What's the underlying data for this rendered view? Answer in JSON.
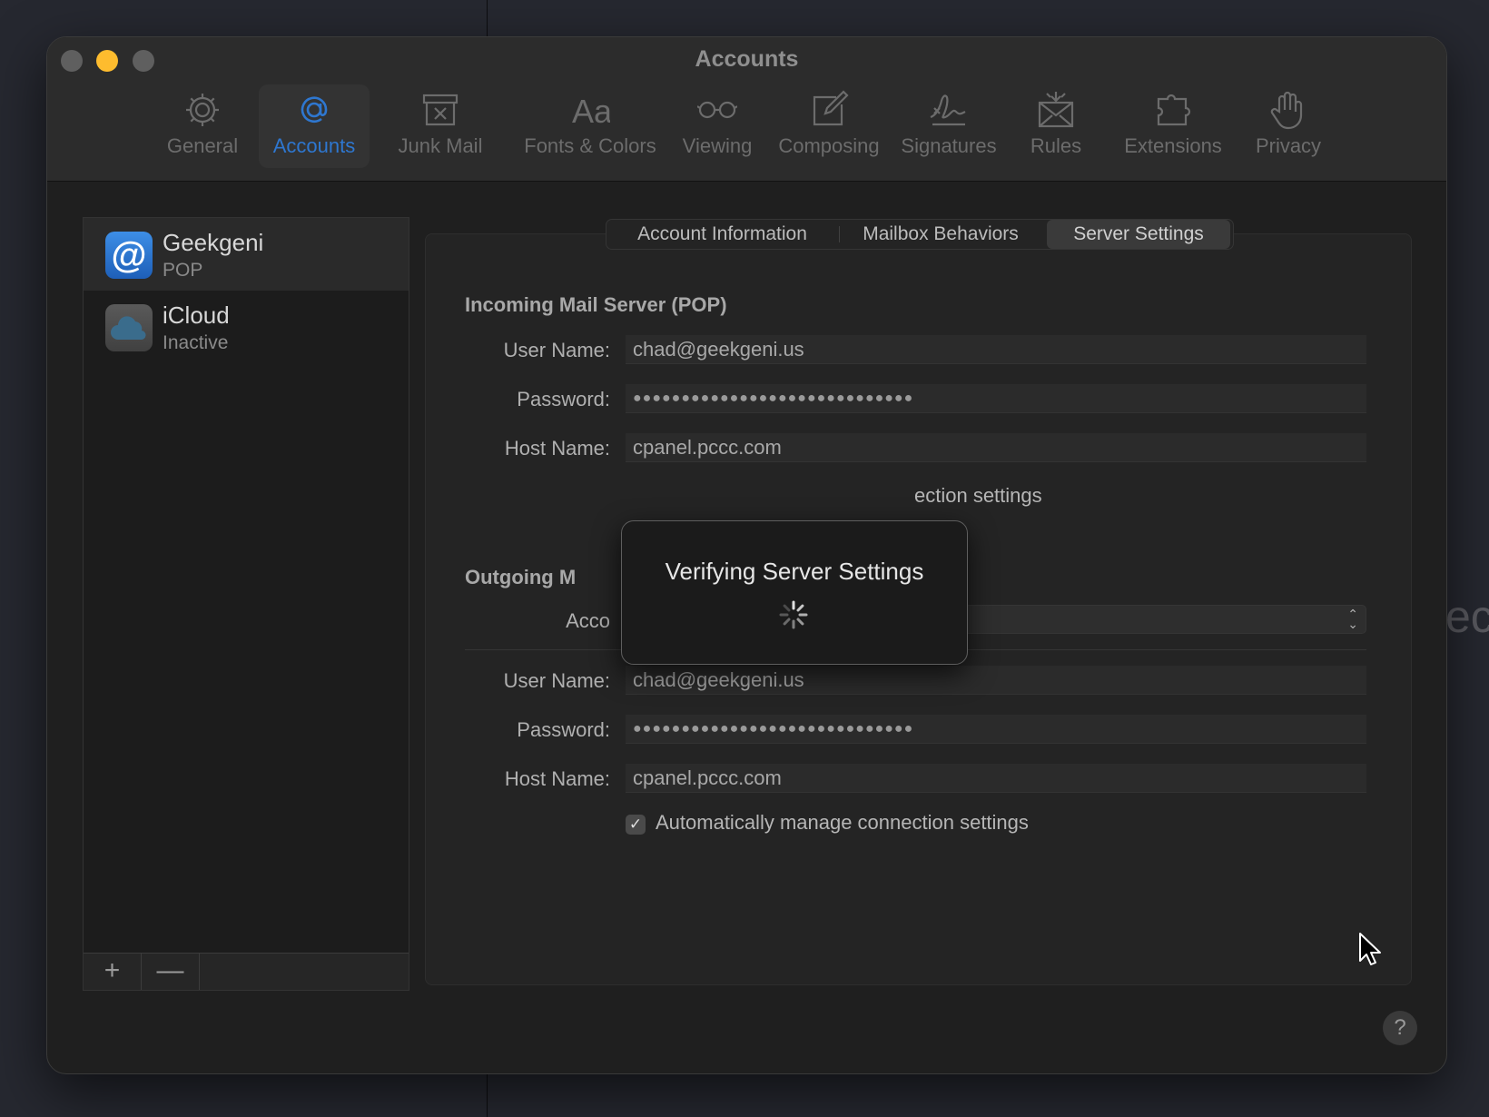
{
  "window": {
    "title": "Accounts"
  },
  "toolbar": {
    "items": [
      {
        "label": "General",
        "icon": "gear-icon"
      },
      {
        "label": "Accounts",
        "icon": "at-icon",
        "selected": true
      },
      {
        "label": "Junk Mail",
        "icon": "junk-mail-icon"
      },
      {
        "label": "Fonts & Colors",
        "icon": "fonts-icon"
      },
      {
        "label": "Viewing",
        "icon": "glasses-icon"
      },
      {
        "label": "Composing",
        "icon": "compose-icon"
      },
      {
        "label": "Signatures",
        "icon": "signature-icon"
      },
      {
        "label": "Rules",
        "icon": "rules-icon"
      },
      {
        "label": "Extensions",
        "icon": "extensions-icon"
      },
      {
        "label": "Privacy",
        "icon": "hand-icon"
      }
    ]
  },
  "accounts": [
    {
      "name": "Geekgeni",
      "type": "POP",
      "selected": true
    },
    {
      "name": "iCloud",
      "type": "Inactive"
    }
  ],
  "sidebar_buttons": {
    "add": "+",
    "remove": "—"
  },
  "tabs": [
    {
      "label": "Account Information"
    },
    {
      "label": "Mailbox Behaviors"
    },
    {
      "label": "Server Settings",
      "selected": true
    }
  ],
  "incoming": {
    "title": "Incoming Mail Server (POP)",
    "user_label": "User Name:",
    "user_value": "chad@geekgeni.us",
    "password_label": "Password:",
    "password_value": "●●●●●●●●●●●●●●●●●●●●●●●●●●●●●",
    "host_label": "Host Name:",
    "host_value": "cpanel.pccc.com",
    "partial_checkbox_text": "ection settings"
  },
  "outgoing": {
    "title_partial": "Outgoing M",
    "account_label_partial": "Acco",
    "user_label": "User Name:",
    "user_value": "chad@geekgeni.us",
    "password_label": "Password:",
    "password_value": "●●●●●●●●●●●●●●●●●●●●●●●●●●●●●",
    "host_label": "Host Name:",
    "host_value": "cpanel.pccc.com",
    "auto_manage_label": "Automatically manage connection settings",
    "auto_manage_checked": true
  },
  "sheet": {
    "title": "Verifying Server Settings"
  },
  "help": {
    "label": "?"
  },
  "background": {
    "partial_text": "ect"
  },
  "colors": {
    "accent": "#2e77d0",
    "traffic_yellow": "#febc2e"
  }
}
